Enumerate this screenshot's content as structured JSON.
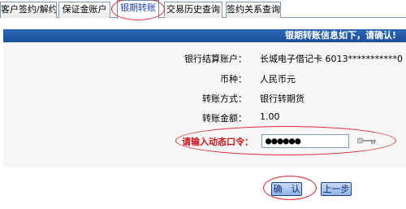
{
  "tabs": [
    {
      "label": "客户签约/解约"
    },
    {
      "label": "保证金账户"
    },
    {
      "label": "银期转账",
      "active": true
    },
    {
      "label": "交易历史查询"
    },
    {
      "label": "签约关系查询"
    }
  ],
  "header": {
    "title": "银期转账信息如下，请确认!"
  },
  "form": {
    "account_label": "银行结算账户：",
    "account_value": "长城电子借记卡 6013***********0",
    "currency_label": "币种：",
    "currency_value": "人民币元",
    "method_label": "转账方式：",
    "method_value": "银行转期货",
    "amount_label": "转账金额：",
    "amount_value": "1.00",
    "password_label": "请输入动态口令：",
    "password_value": "●●●●●●"
  },
  "buttons": {
    "confirm": "确　认",
    "back": "上一步"
  },
  "colors": {
    "accent": "#1d4f98",
    "highlight": "#d9252b",
    "warning_text": "#c8141c"
  }
}
